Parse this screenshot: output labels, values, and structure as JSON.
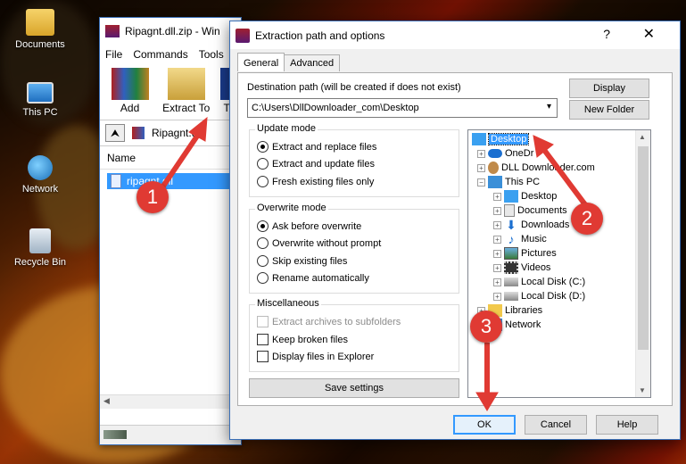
{
  "desktop": {
    "icons": [
      {
        "label": "Documents"
      },
      {
        "label": "This PC"
      },
      {
        "label": "Network"
      },
      {
        "label": "Recycle Bin"
      }
    ]
  },
  "winrar": {
    "title": "Ripagnt.dll.zip - Win",
    "menu": [
      "File",
      "Commands",
      "Tools"
    ],
    "toolbar": {
      "add": "Add",
      "extract_to": "Extract To",
      "next": "T"
    },
    "path": "Ripagnt.dll.",
    "column_name": "Name",
    "selected_file": "ripagnt.dll"
  },
  "dialog": {
    "title": "Extraction path and options",
    "help_glyph": "?",
    "close_glyph": "✕",
    "tabs": {
      "general": "General",
      "advanced": "Advanced"
    },
    "destination_label": "Destination path (will be created if does not exist)",
    "destination_value": "C:\\Users\\DllDownloader_com\\Desktop",
    "display_button": "Display",
    "new_folder_button": "New Folder",
    "update_mode": {
      "title": "Update mode",
      "options": [
        "Extract and replace files",
        "Extract and update files",
        "Fresh existing files only"
      ],
      "selected": 0
    },
    "overwrite_mode": {
      "title": "Overwrite mode",
      "options": [
        "Ask before overwrite",
        "Overwrite without prompt",
        "Skip existing files",
        "Rename automatically"
      ],
      "selected": 0
    },
    "misc": {
      "title": "Miscellaneous",
      "options": [
        "Extract archives to subfolders",
        "Keep broken files",
        "Display files in Explorer"
      ]
    },
    "save_settings": "Save settings",
    "tree": {
      "desktop": "Desktop",
      "onedrive": "OneDr",
      "dll": "DLL Downloader.com",
      "thispc": "This PC",
      "pc_desktop": "Desktop",
      "documents": "Documents",
      "downloads": "Downloads",
      "music": "Music",
      "pictures": "Pictures",
      "videos": "Videos",
      "local_c": "Local Disk (C:)",
      "local_d": "Local Disk (D:)",
      "libraries": "Libraries",
      "network": "Network"
    },
    "ok": "OK",
    "cancel": "Cancel",
    "help": "Help"
  },
  "annotations": {
    "m1": "1",
    "m2": "2",
    "m3": "3"
  },
  "colors": {
    "accent": "#3399ff",
    "marker": "#e03a33"
  }
}
